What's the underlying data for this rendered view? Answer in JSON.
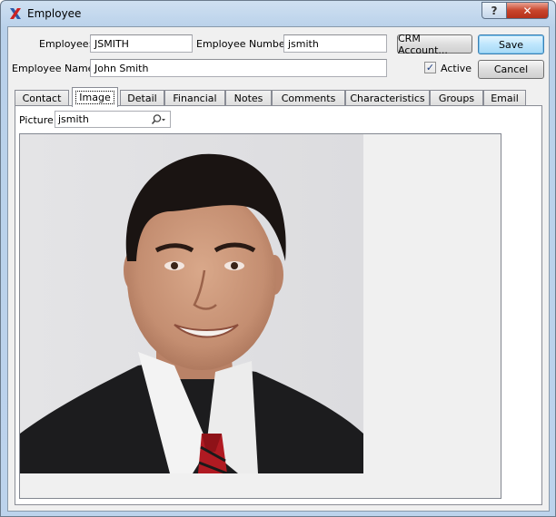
{
  "window": {
    "title": "Employee",
    "help_label": "?",
    "close_label": "✕"
  },
  "form": {
    "employee_label": "Employee:",
    "employee_value": "JSMITH",
    "employee_number_label": "Employee Number:",
    "employee_number_value": "jsmith",
    "employee_name_label": "Employee Name:",
    "employee_name_value": "John Smith",
    "active_label": "Active",
    "active_checked": true,
    "crm_account_label": "CRM Account...",
    "save_label": "Save",
    "cancel_label": "Cancel"
  },
  "tabs": [
    {
      "label": "Contact"
    },
    {
      "label": "Image"
    },
    {
      "label": "Detail"
    },
    {
      "label": "Financial"
    },
    {
      "label": "Notes"
    },
    {
      "label": "Comments"
    },
    {
      "label": "Characteristics"
    },
    {
      "label": "Groups"
    },
    {
      "label": "Email"
    }
  ],
  "active_tab": "Image",
  "image_tab": {
    "picture_label": "Picture:",
    "picture_value": "jsmith",
    "lookup_icon": "search-icon"
  },
  "colors": {
    "accent": "#3c7fb1",
    "close_red": "#c8452c",
    "app_icon_blue": "#2d5aa8",
    "app_icon_red": "#cc2222"
  }
}
